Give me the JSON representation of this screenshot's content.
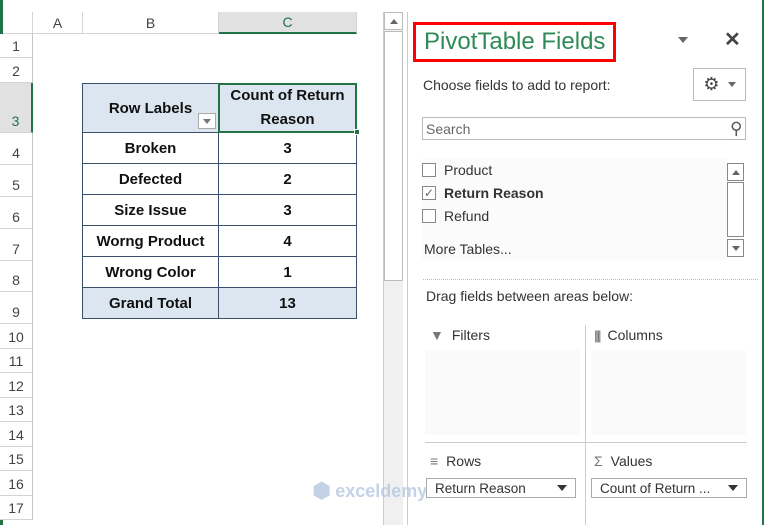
{
  "sheet": {
    "columns": [
      "A",
      "B",
      "C"
    ],
    "rows": [
      "1",
      "2",
      "3",
      "4",
      "5",
      "6",
      "7",
      "8",
      "9",
      "10",
      "11",
      "12",
      "13",
      "14",
      "15",
      "16",
      "17"
    ],
    "pivot": {
      "header_row_labels": "Row Labels",
      "header_value": "Count of Return Reason",
      "rows": [
        {
          "label": "Broken",
          "value": "3"
        },
        {
          "label": "Defected",
          "value": "2"
        },
        {
          "label": "Size Issue",
          "value": "3"
        },
        {
          "label": "Worng Product",
          "value": "4"
        },
        {
          "label": "Wrong Color",
          "value": "1"
        }
      ],
      "total_label": "Grand Total",
      "total_value": "13"
    }
  },
  "pane": {
    "title": "PivotTable Fields",
    "choose_label": "Choose fields to add to report:",
    "search_placeholder": "Search",
    "fields": [
      {
        "label": "Product",
        "checked": false
      },
      {
        "label": "Return Reason",
        "checked": true
      },
      {
        "label": "Refund",
        "checked": false
      }
    ],
    "more_tables": "More Tables...",
    "drag_label": "Drag fields between areas below:",
    "areas": {
      "filters": "Filters",
      "columns": "Columns",
      "rows": "Rows",
      "values": "Values",
      "rows_item": "Return Reason",
      "values_item": "Count of Return ..."
    }
  },
  "watermark": "exceldemy EXCEL · DATA · BI",
  "colors": {
    "accent": "#217346",
    "title": "#2e8b57",
    "highlight": "#ff0000",
    "pivot_header": "#dce6f1"
  }
}
